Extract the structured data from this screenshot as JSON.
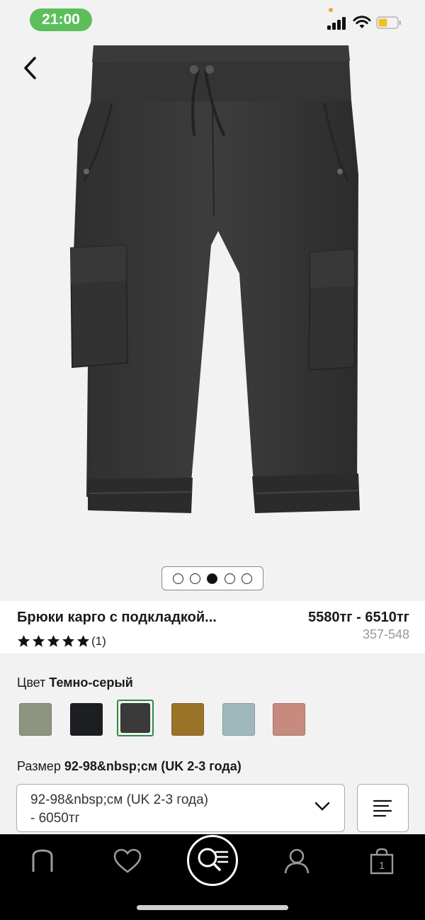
{
  "status_bar": {
    "time": "21:00"
  },
  "product": {
    "title": "Брюки карго с подкладкой...",
    "price_range": "5580тг - 6510тг",
    "rating_stars": 5,
    "review_count": "(1)",
    "sku": "357-548",
    "image_alt": "Темно-серые детские брюки карго",
    "carousel": {
      "total": 5,
      "active_index": 2
    }
  },
  "color": {
    "label": "Цвет",
    "selected_name": "Темно-серый",
    "swatches": [
      {
        "name": "хаки",
        "hex": "#8e957f"
      },
      {
        "name": "черный",
        "hex": "#1d1e22"
      },
      {
        "name": "темно-серый",
        "hex": "#3a3a3b"
      },
      {
        "name": "горчичный",
        "hex": "#9a7328"
      },
      {
        "name": "голубой",
        "hex": "#9fb8bb"
      },
      {
        "name": "розовый",
        "hex": "#c68a7f"
      }
    ],
    "selected_index": 2
  },
  "size": {
    "label": "Размер",
    "selected_value": "92-98&nbsp;см (UK 2-3 года)",
    "select_line1": "92-98&nbsp;см (UK 2-3 года)",
    "select_line2": "- 6050тг"
  },
  "nav": {
    "items": [
      "home-icon",
      "heart-icon",
      "search-icon",
      "user-icon",
      "bag-icon"
    ],
    "bag_count": "1"
  },
  "colors": {
    "accent_green": "#2f8a3f",
    "status_green": "#5cbf5c",
    "nav_bg": "#000000",
    "sku_grey": "#9a9a9a"
  }
}
